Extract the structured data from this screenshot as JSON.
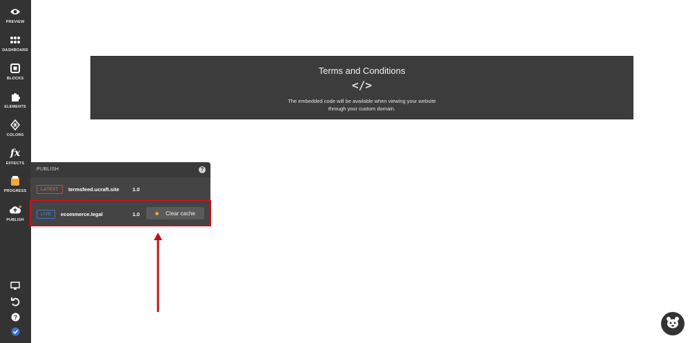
{
  "sidebar": {
    "items": [
      {
        "label": "PREVIEW",
        "icon": "eye-icon"
      },
      {
        "label": "DASHBOARD",
        "icon": "grid-icon"
      },
      {
        "label": "BLOCKS",
        "icon": "blocks-icon"
      },
      {
        "label": "ELEMENTS",
        "icon": "puzzle-icon"
      },
      {
        "label": "COLORS",
        "icon": "palette-icon"
      },
      {
        "label": "EFFECTS",
        "icon": "fx-icon"
      },
      {
        "label": "PROGRESS",
        "icon": "progress-icon"
      },
      {
        "label": "PUBLISH",
        "icon": "cloud-upload-icon"
      }
    ],
    "bottom_icons": [
      "monitor-icon",
      "undo-icon",
      "help-icon",
      "check-icon"
    ]
  },
  "embed": {
    "title": "Terms and Conditions",
    "code_symbol": "</>",
    "message_line1": "The embedded code will be available when viewing your website",
    "message_line2": "through your custom domain."
  },
  "publish_panel": {
    "title": "PUBLISH",
    "help_symbol": "?",
    "rows": [
      {
        "badge": "LATEST",
        "domain": "termsfeed.ucraft.site",
        "version": "1.0"
      },
      {
        "badge": "LIVE",
        "domain": "ecommerce.legal",
        "version": "1.0",
        "action": "Clear cache"
      }
    ]
  },
  "colors": {
    "sidebar_bg": "#333333",
    "panel_bg": "#444444",
    "highlight": "#d0101a",
    "latest_badge": "#c0523f",
    "live_badge": "#3d7ac7",
    "status_dot": "#f0a030"
  }
}
